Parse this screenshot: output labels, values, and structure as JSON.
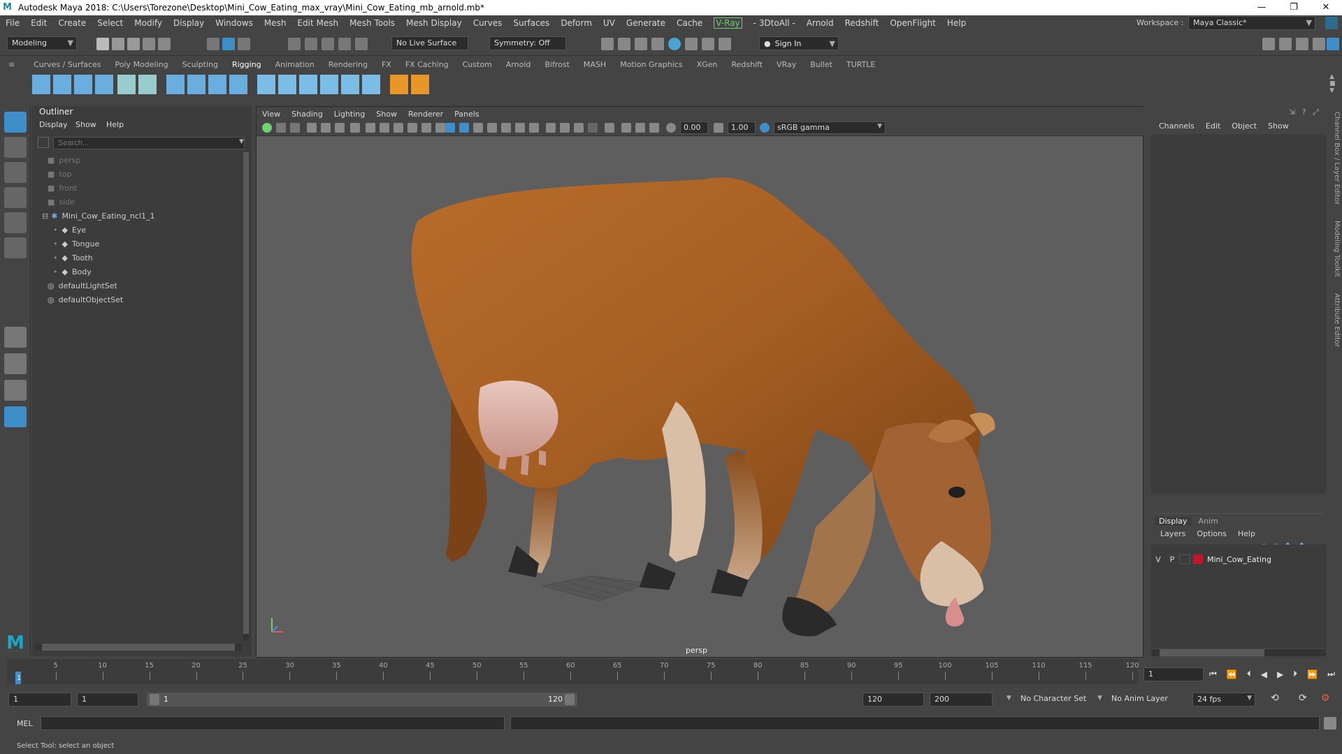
{
  "window": {
    "title": "Autodesk Maya 2018: C:\\Users\\Torezone\\Desktop\\Mini_Cow_Eating_max_vray\\Mini_Cow_Eating_mb_arnold.mb*",
    "minimize": "—",
    "restore": "❐",
    "close": "✕"
  },
  "menubar": {
    "items": [
      "File",
      "Edit",
      "Create",
      "Select",
      "Modify",
      "Display",
      "Windows",
      "Mesh",
      "Edit Mesh",
      "Mesh Tools",
      "Mesh Display",
      "Curves",
      "Surfaces",
      "Deform",
      "UV",
      "Generate",
      "Cache"
    ],
    "vray": "V-Ray",
    "items2": [
      "- 3DtoAll -",
      "Arnold",
      "Redshift",
      "OpenFlight",
      "Help"
    ],
    "workspace_label": "Workspace :",
    "workspace_value": "Maya Classic*"
  },
  "statusline": {
    "mode": "Modeling",
    "live_surface": "No Live Surface",
    "symmetry": "Symmetry: Off",
    "sign_in": "Sign In"
  },
  "shelf": {
    "tabs": [
      "Curves / Surfaces",
      "Poly Modeling",
      "Sculpting",
      "Rigging",
      "Animation",
      "Rendering",
      "FX",
      "FX Caching",
      "Custom",
      "Arnold",
      "Bifrost",
      "MASH",
      "Motion Graphics",
      "XGen",
      "Redshift",
      "VRay",
      "Bullet",
      "TURTLE"
    ],
    "active_tab": "Rigging"
  },
  "outliner": {
    "title": "Outliner",
    "menu": [
      "Display",
      "Show",
      "Help"
    ],
    "search_placeholder": "Search...",
    "items": [
      {
        "label": "persp",
        "dim": true
      },
      {
        "label": "top",
        "dim": true
      },
      {
        "label": "front",
        "dim": true
      },
      {
        "label": "side",
        "dim": true
      },
      {
        "label": "Mini_Cow_Eating_ncl1_1",
        "dim": false
      },
      {
        "label": "Eye",
        "dim": false
      },
      {
        "label": "Tongue",
        "dim": false
      },
      {
        "label": "Tooth",
        "dim": false
      },
      {
        "label": "Body",
        "dim": false
      },
      {
        "label": "defaultLightSet",
        "dim": false
      },
      {
        "label": "defaultObjectSet",
        "dim": false
      }
    ]
  },
  "viewport": {
    "menu": [
      "View",
      "Shading",
      "Lighting",
      "Show",
      "Renderer",
      "Panels"
    ],
    "exposure": "0.00",
    "gamma": "1.00",
    "color_space": "sRGB gamma",
    "camera_label": "persp"
  },
  "channelbox": {
    "menu": [
      "Channels",
      "Edit",
      "Object",
      "Show"
    ],
    "side_tabs": [
      "Channel Box / Layer Editor",
      "Modeling Toolkit",
      "Attribute Editor"
    ],
    "layer_tabs": [
      "Display",
      "Anim"
    ],
    "layer_menu": [
      "Layers",
      "Options",
      "Help"
    ],
    "layer_row": {
      "v": "V",
      "p": "P",
      "name": "Mini_Cow_Eating",
      "color": "#c0162b"
    }
  },
  "timeline": {
    "ticks": [
      "5",
      "10",
      "15",
      "20",
      "25",
      "30",
      "35",
      "40",
      "45",
      "50",
      "55",
      "60",
      "65",
      "70",
      "75",
      "80",
      "85",
      "90",
      "95",
      "100",
      "105",
      "110",
      "115",
      "120"
    ],
    "start_frame": "1",
    "current_frame": "1"
  },
  "range": {
    "start": "1",
    "playback_start": "1",
    "slider_start": "1",
    "slider_end": "120",
    "playback_end": "120",
    "end": "200",
    "character_set": "No Character Set",
    "anim_layer": "No Anim Layer",
    "fps": "24 fps"
  },
  "cmdline": {
    "lang": "MEL"
  },
  "helpline": {
    "text": "Select Tool: select an object"
  },
  "colors": {
    "accent": "#3d8ec9",
    "panel": "#444444",
    "viewport_bg": "#5e5e5e"
  }
}
